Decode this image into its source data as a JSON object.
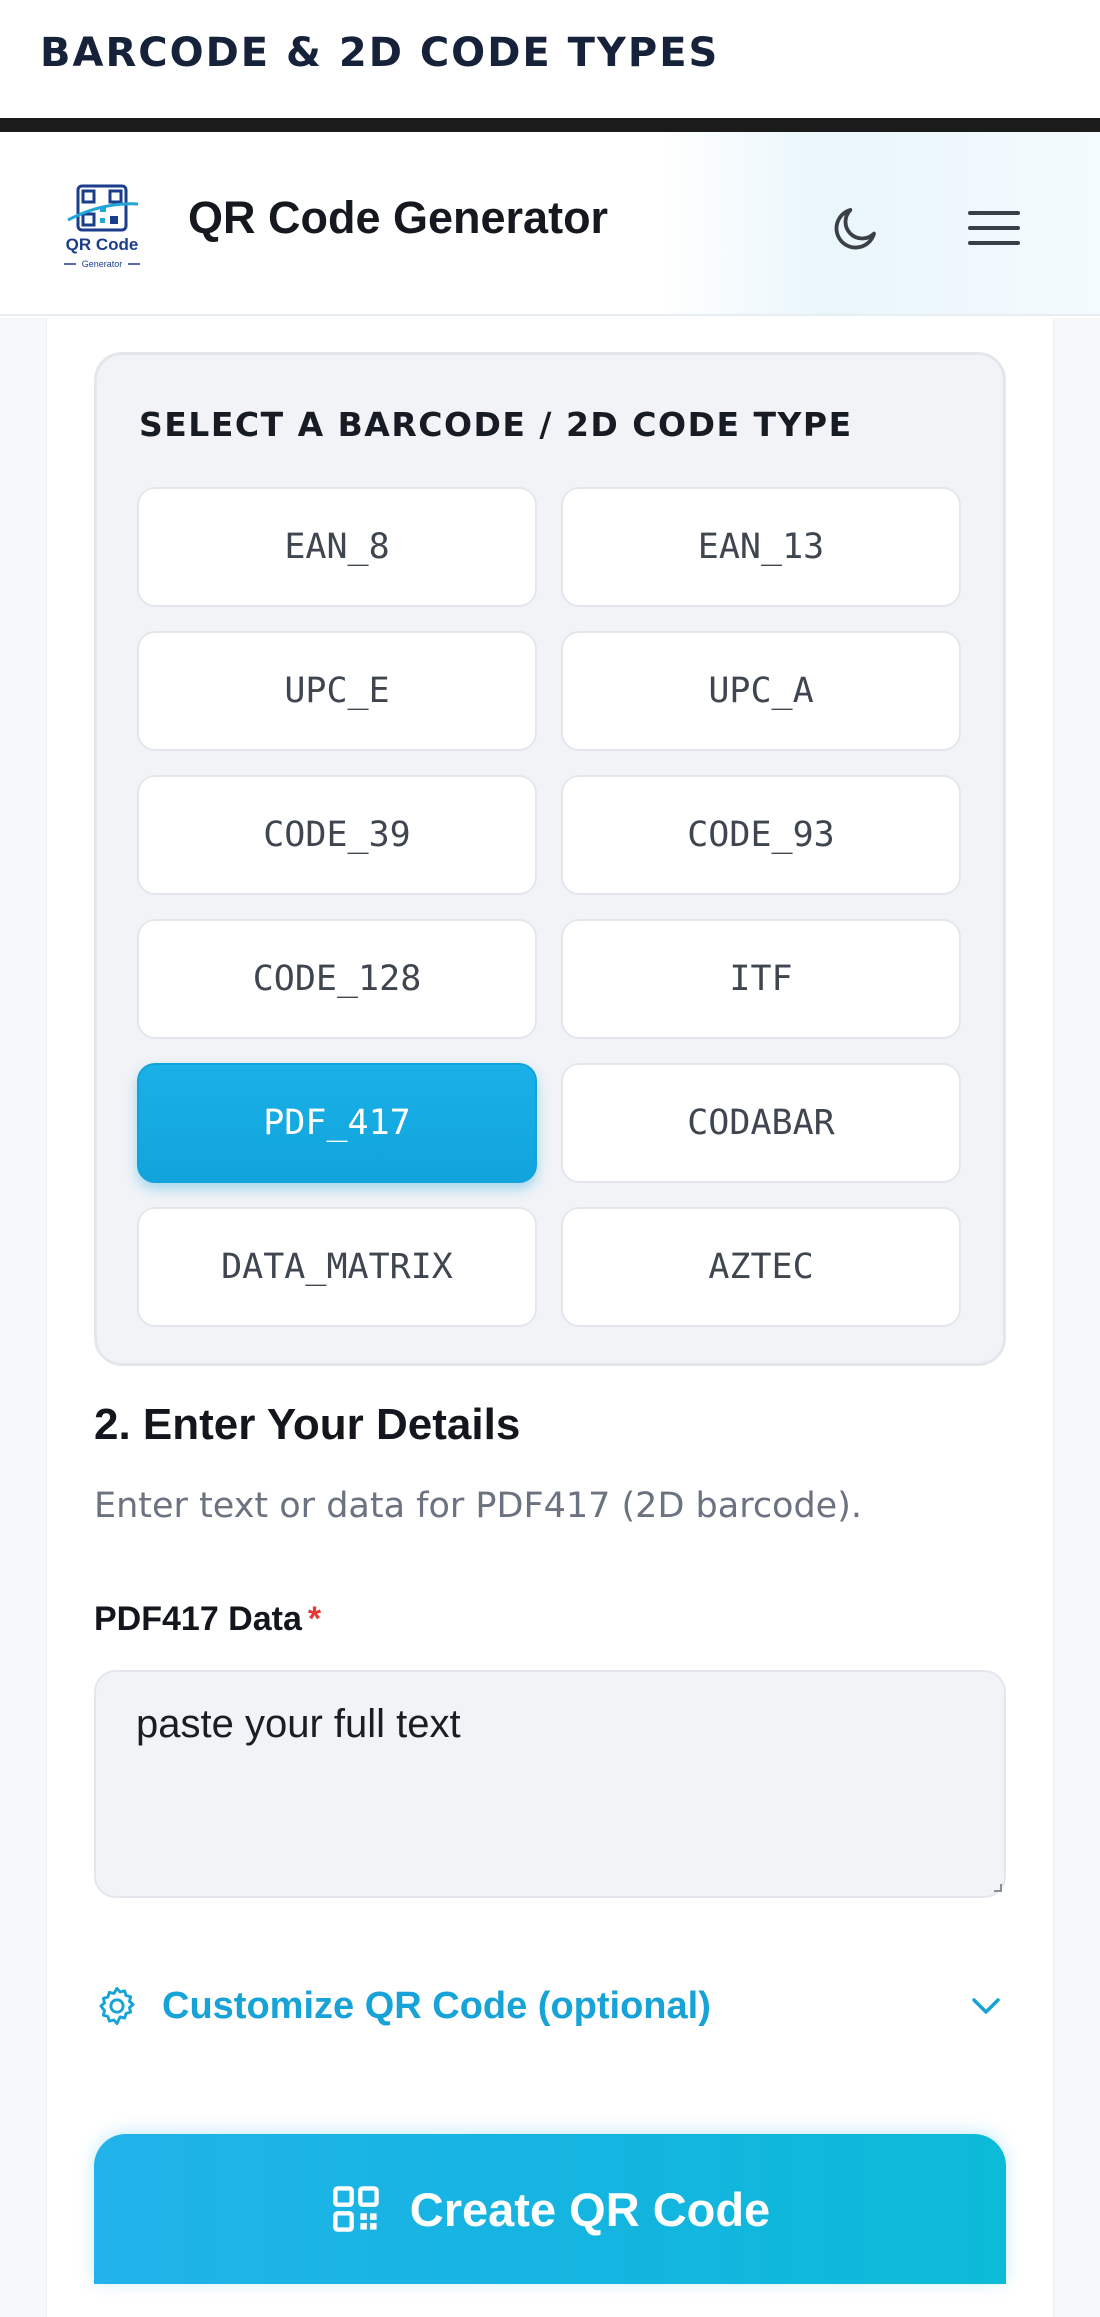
{
  "caption": {
    "text": "BARCODE & 2D CODE TYPES"
  },
  "header": {
    "logo_line1": "QR Code",
    "logo_line2": "Generator",
    "title": "QR Code Generator",
    "theme_icon": "moon-icon",
    "menu_icon": "hamburger-menu-icon"
  },
  "type_selector": {
    "heading": "SELECT A BARCODE / 2D CODE TYPE",
    "selected": "PDF_417",
    "types": [
      "EAN_8",
      "EAN_13",
      "UPC_E",
      "UPC_A",
      "CODE_39",
      "CODE_93",
      "CODE_128",
      "ITF",
      "PDF_417",
      "CODABAR",
      "DATA_MATRIX",
      "AZTEC"
    ]
  },
  "details": {
    "title": "2. Enter Your Details",
    "description": "Enter text or data for PDF417 (2D barcode).",
    "field_label": "PDF417 Data",
    "required_mark": "*",
    "field_value": "paste your full text"
  },
  "customize": {
    "label": "Customize QR Code (optional)",
    "icon": "gear-icon",
    "toggle_icon": "chevron-down-icon"
  },
  "create_button": {
    "label": "Create QR Code",
    "icon": "qr-code-icon"
  },
  "colors": {
    "accent": "#17a3d8",
    "active_button": "#19b1e7",
    "panel_bg": "#f1f3f7",
    "required": "#e53935"
  }
}
